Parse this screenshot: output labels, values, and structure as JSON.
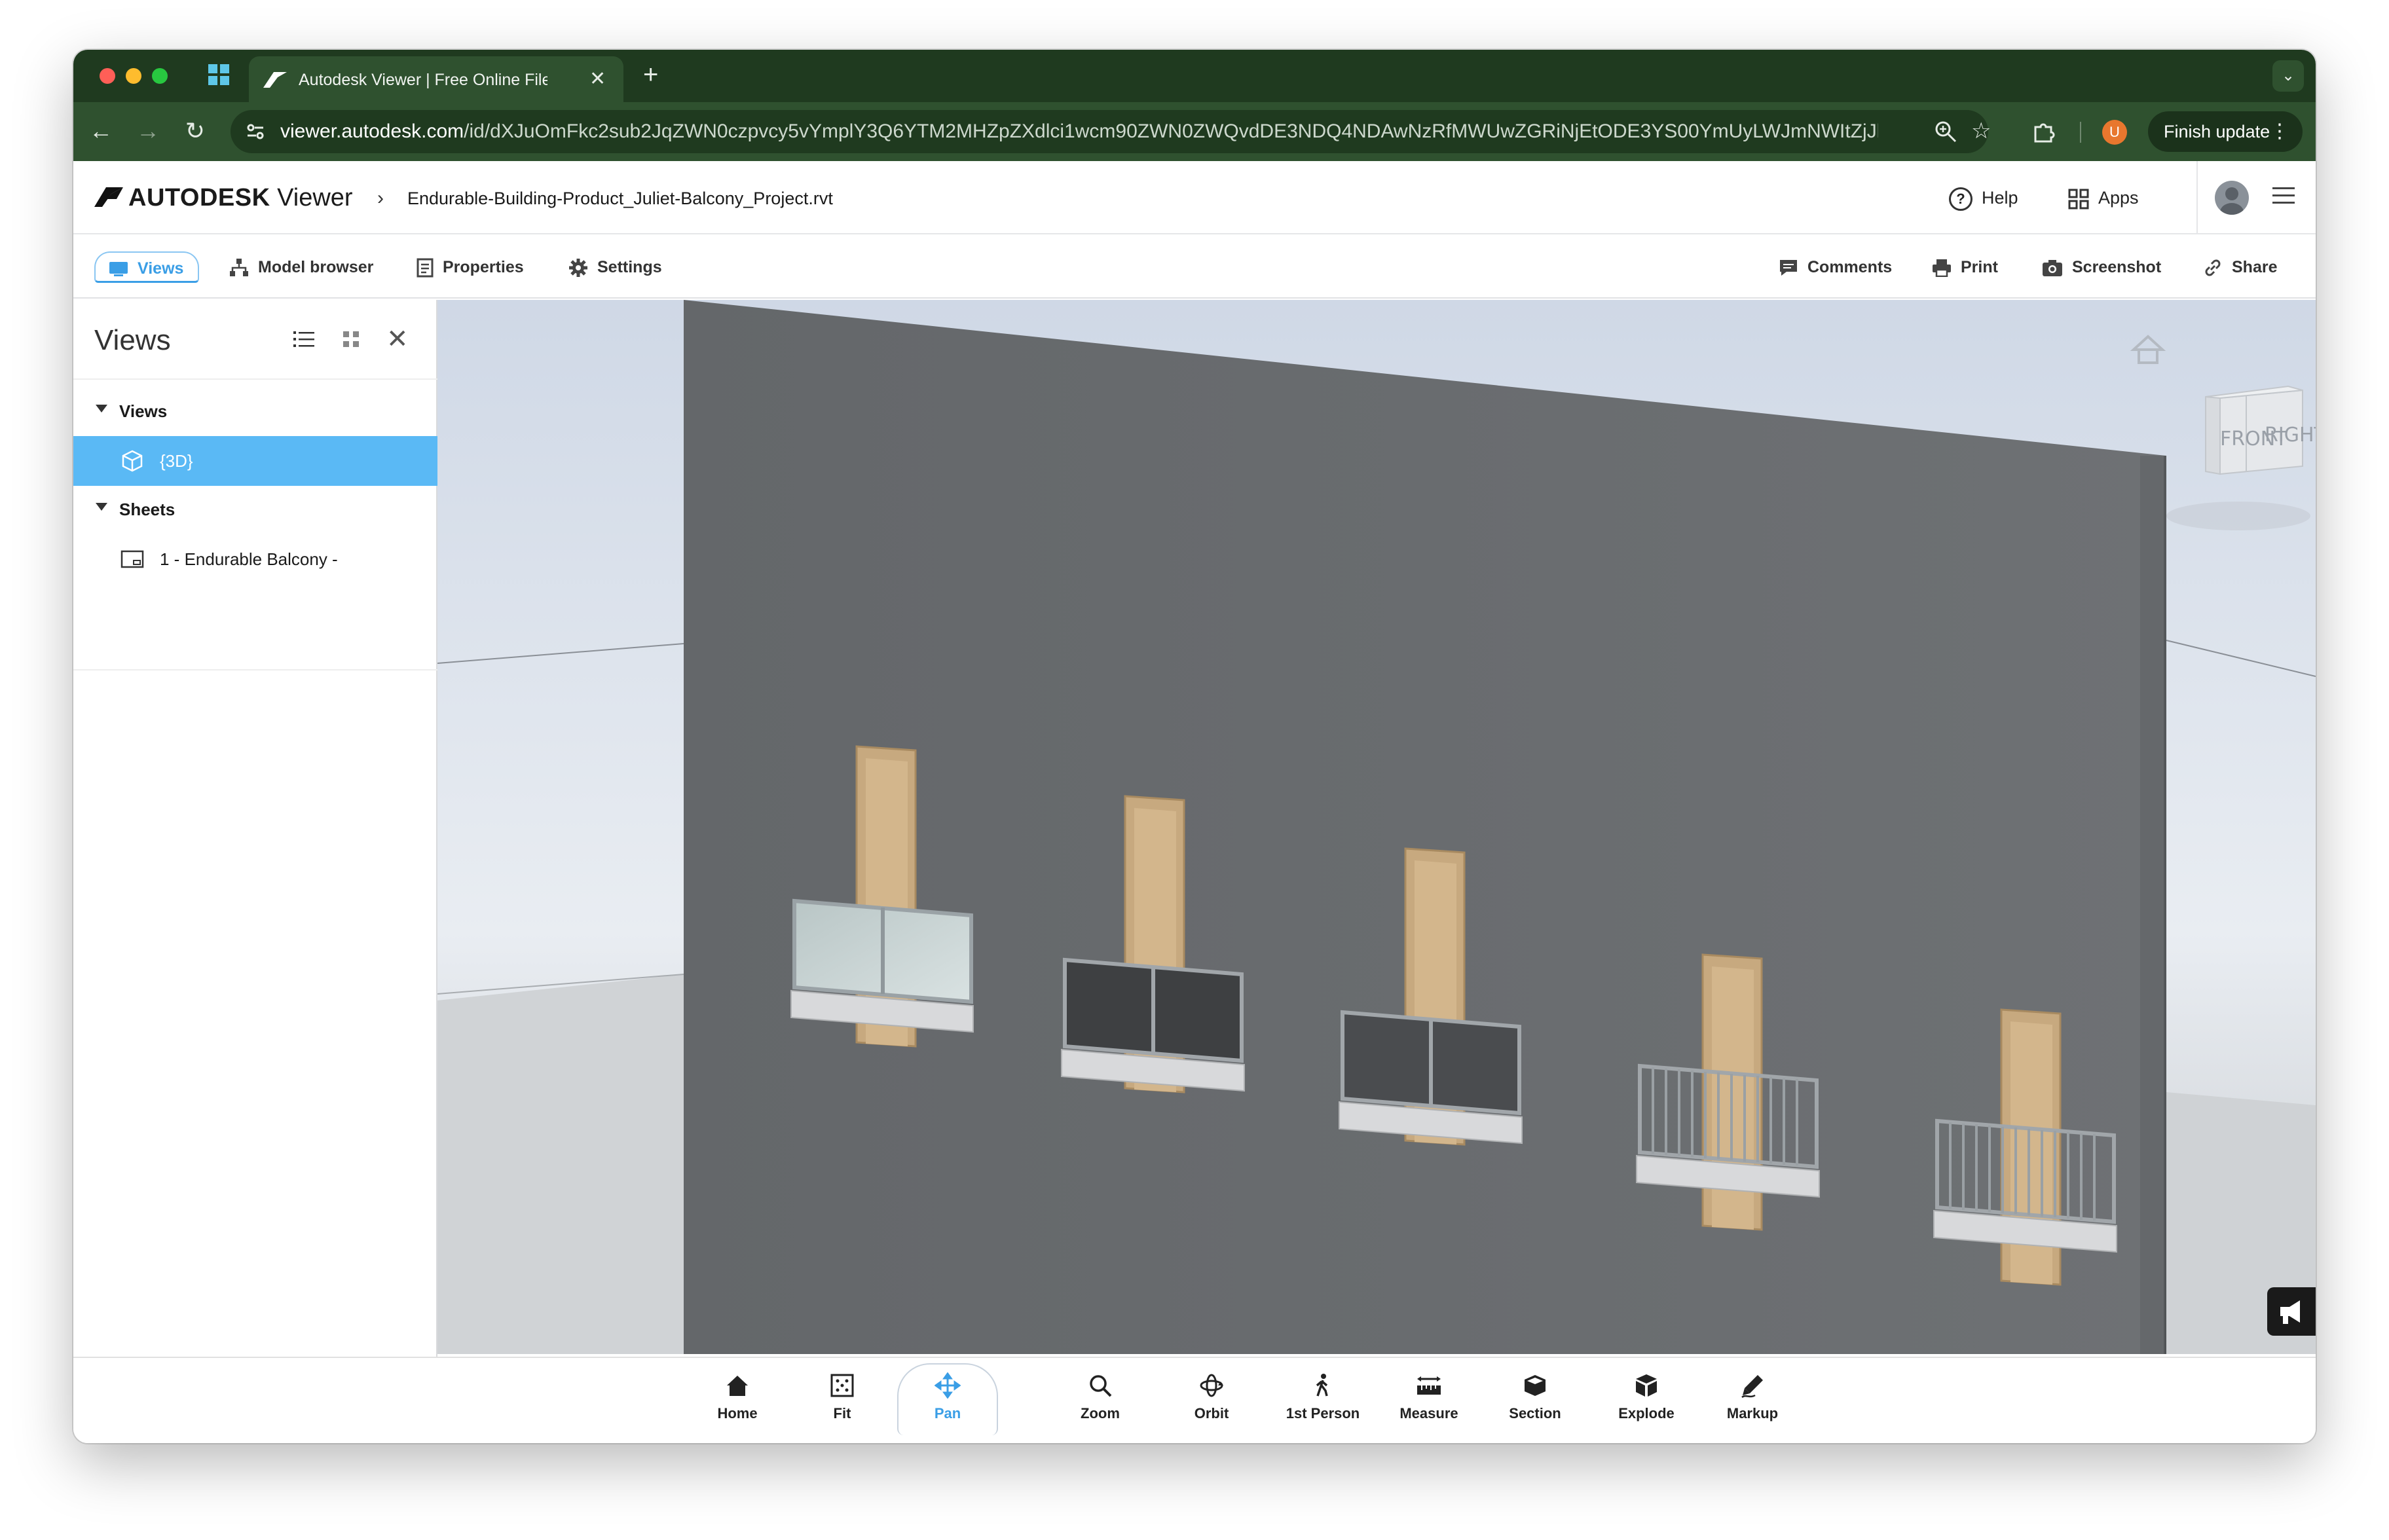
{
  "browser": {
    "tab_title": "Autodesk Viewer | Free Online File Viewer",
    "url_host": "viewer.autodesk.com",
    "url_path": "/id/dXJuOmFkc2sub2JqZWN0czpvcy5vYmplY3Q6YTM2MHZpZXdlci1wcm90ZWN0ZWQvdDE3NDQ4NDAwNzRfMWUwZGRiNjEtODE3YS00YmUyLWJmNWItZjJlMWU...",
    "profile_initial": "U",
    "finish_update_label": "Finish update"
  },
  "app": {
    "brand_main": "AUTODESK",
    "brand_product": "Viewer",
    "file_name": "Endurable-Building-Product_Juliet-Balcony_Project.rvt",
    "help_label": "Help",
    "apps_label": "Apps"
  },
  "toolbar": {
    "views": "Views",
    "model_browser": "Model browser",
    "properties": "Properties",
    "settings": "Settings",
    "comments": "Comments",
    "print": "Print",
    "screenshot": "Screenshot",
    "share": "Share"
  },
  "panel": {
    "title": "Views",
    "groups": [
      {
        "label": "Views",
        "items": [
          {
            "label": "{3D}",
            "selected": true
          }
        ]
      },
      {
        "label": "Sheets",
        "items": [
          {
            "label": "1 - Endurable Balcony -",
            "selected": false
          }
        ]
      }
    ]
  },
  "viewcube": {
    "front": "FRONT",
    "right": "RIGHT"
  },
  "bottom_nav": {
    "home": "Home",
    "fit": "Fit",
    "pan": "Pan",
    "zoom": "Zoom",
    "orbit": "Orbit",
    "first_person": "1st Person",
    "measure": "Measure",
    "section": "Section",
    "explode": "Explode",
    "markup": "Markup"
  },
  "colors": {
    "accent": "#3a9ee6",
    "selected_row": "#5ab9f5",
    "browser_frame": "#1f3a1f",
    "wall": "#6b6e71"
  }
}
